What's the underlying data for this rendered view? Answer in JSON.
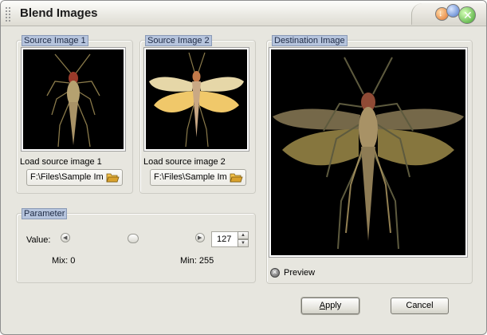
{
  "window": {
    "title": "Blend Images"
  },
  "source1": {
    "legend": "Source Image 1",
    "load_label": "Load source image 1",
    "path": "F:\\Files\\Sample Im"
  },
  "source2": {
    "legend": "Source Image 2",
    "load_label": "Load source image 2",
    "path": "F:\\Files\\Sample Im"
  },
  "destination": {
    "legend": "Destination Image",
    "preview_label": "Preview"
  },
  "parameter": {
    "legend": "Parameter",
    "value_label": "Value:",
    "value": "127",
    "slider_level": 0.5,
    "mix_label": "Mix: 0",
    "min_label": "Min: 255"
  },
  "buttons": {
    "apply_first": "A",
    "apply_rest": "pply",
    "cancel": "Cancel"
  },
  "icons": {
    "folder": "open-folder-icon",
    "preview": "close-circle-icon"
  },
  "colors": {
    "legend_bg": "#b6c4dd",
    "window_bg": "#e7e6df",
    "close_button": "#3fa12c"
  }
}
